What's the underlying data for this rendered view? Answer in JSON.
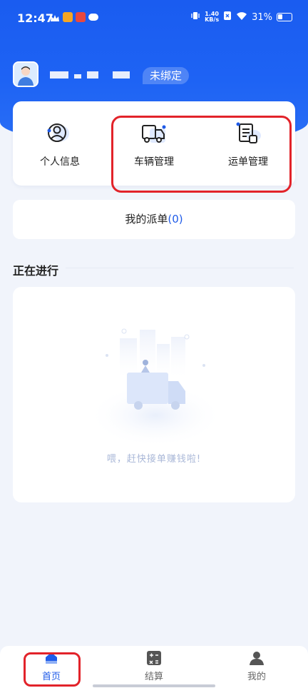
{
  "status_bar": {
    "time": "12:47",
    "net_speed_value": "1.40",
    "net_speed_unit": "KB/s",
    "battery": "31%"
  },
  "profile": {
    "bind_status": "未绑定"
  },
  "functions": [
    {
      "label": "个人信息",
      "icon": "person-icon"
    },
    {
      "label": "车辆管理",
      "icon": "truck-icon"
    },
    {
      "label": "运单管理",
      "icon": "waybill-icon"
    }
  ],
  "dispatch": {
    "label": "我的派单",
    "count": "(0)"
  },
  "ongoing": {
    "title": "正在进行",
    "empty_text": "喂，赶快接单赚钱啦!"
  },
  "tabs": [
    {
      "label": "首页",
      "icon": "home-icon",
      "active": true
    },
    {
      "label": "结算",
      "icon": "calculator-icon",
      "active": false
    },
    {
      "label": "我的",
      "icon": "user-icon",
      "active": false
    }
  ],
  "colors": {
    "brand_blue": "#1f5be8",
    "highlight_red": "#e2232a"
  }
}
